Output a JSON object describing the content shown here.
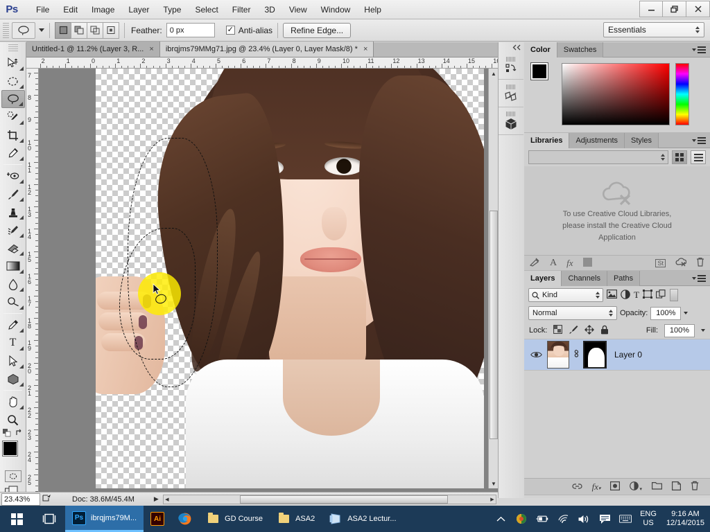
{
  "app": {
    "name": "Ps",
    "workspace": "Essentials"
  },
  "menubar": {
    "items": [
      {
        "label": "File"
      },
      {
        "label": "Edit"
      },
      {
        "label": "Image"
      },
      {
        "label": "Layer"
      },
      {
        "label": "Type"
      },
      {
        "label": "Select"
      },
      {
        "label": "Filter"
      },
      {
        "label": "3D"
      },
      {
        "label": "View"
      },
      {
        "label": "Window"
      },
      {
        "label": "Help"
      }
    ]
  },
  "window_controls": {
    "minimize": "—",
    "restore": "❐",
    "close": "✕"
  },
  "options_bar": {
    "tool": "lasso-tool",
    "modes": [
      {
        "name": "new-selection",
        "active": true
      },
      {
        "name": "add-to-selection",
        "active": false
      },
      {
        "name": "subtract-from-selection",
        "active": false
      },
      {
        "name": "intersect-with-selection",
        "active": false
      }
    ],
    "feather_label": "Feather:",
    "feather_value": "0 px",
    "antialias_label": "Anti-alias",
    "antialias_checked": true,
    "refine_edge_label": "Refine Edge..."
  },
  "document_tabs": [
    {
      "title": "Untitled-1 @ 11.2% (Layer 3, R...",
      "active": false,
      "close": "×"
    },
    {
      "title": "ibrqjms79MMg71.jpg @ 23.4% (Layer 0, Layer Mask/8) *",
      "active": true,
      "close": "×"
    }
  ],
  "toolbox": {
    "tools": [
      {
        "name": "move-tool",
        "glyph": "✥",
        "selected": false
      },
      {
        "name": "elliptical-marquee-tool",
        "glyph": "○",
        "selected": false
      },
      {
        "name": "lasso-tool",
        "glyph": "℘",
        "selected": true
      },
      {
        "name": "quick-selection-tool",
        "glyph": "✒",
        "selected": false
      },
      {
        "name": "crop-tool",
        "glyph": "⌗",
        "selected": false
      },
      {
        "name": "eyedropper-tool",
        "glyph": "✎",
        "selected": false
      },
      {
        "name": "spot-healing-brush-tool",
        "glyph": "◎",
        "selected": false
      },
      {
        "name": "brush-tool",
        "glyph": "✐",
        "selected": false
      },
      {
        "name": "clone-stamp-tool",
        "glyph": "⚑",
        "selected": false
      },
      {
        "name": "history-brush-tool",
        "glyph": "✒",
        "selected": false
      },
      {
        "name": "eraser-tool",
        "glyph": "◢",
        "selected": false
      },
      {
        "name": "gradient-tool",
        "glyph": "■",
        "selected": false
      },
      {
        "name": "blur-tool",
        "glyph": "○",
        "selected": false
      },
      {
        "name": "dodge-tool",
        "glyph": "◔",
        "selected": false
      },
      {
        "name": "pen-tool",
        "glyph": "✒",
        "selected": false
      },
      {
        "name": "horizontal-type-tool",
        "glyph": "T",
        "selected": false
      },
      {
        "name": "path-selection-tool",
        "glyph": "➤",
        "selected": false
      },
      {
        "name": "polygon-tool",
        "glyph": "⬡",
        "selected": false
      },
      {
        "name": "hand-tool",
        "glyph": "✋",
        "selected": false
      },
      {
        "name": "zoom-tool",
        "glyph": "⚲",
        "selected": false
      }
    ],
    "foreground_color": "#000000",
    "background_color": "#ffffff"
  },
  "rulers": {
    "horizontal_ticks": [
      "2",
      "1",
      "0",
      "1",
      "2",
      "3",
      "4",
      "5",
      "6",
      "7",
      "8",
      "9",
      "10",
      "11",
      "12",
      "13",
      "14",
      "15",
      "16"
    ],
    "vertical_ticks": [
      "7",
      "8",
      "9",
      "10",
      "11",
      "12",
      "13",
      "14",
      "15",
      "16",
      "17",
      "18",
      "19",
      "20",
      "21",
      "22",
      "23",
      "24",
      "25"
    ]
  },
  "canvas": {
    "brush_overlay_color": "#ffed00",
    "cursor": "lasso-cursor"
  },
  "status_bar": {
    "zoom": "23.43%",
    "doc_info": "Doc: 38.6M/45.4M"
  },
  "dock_rail": {
    "buttons": [
      {
        "name": "history-panel-icon"
      },
      {
        "name": "properties-panel-icon"
      },
      {
        "name": "3d-panel-icon"
      }
    ],
    "collapse": "«"
  },
  "color_panel": {
    "tabs": [
      {
        "label": "Color",
        "active": true
      },
      {
        "label": "Swatches",
        "active": false
      }
    ],
    "foreground": "#000000",
    "background": "#ffffff"
  },
  "libraries_panel": {
    "tabs": [
      {
        "label": "Libraries",
        "active": true
      },
      {
        "label": "Adjustments",
        "active": false
      },
      {
        "label": "Styles",
        "active": false
      }
    ],
    "select_value": "",
    "message_line1": "To use Creative Cloud Libraries,",
    "message_line2": "please install the Creative Cloud",
    "message_line3": "Application",
    "footer_icons": [
      {
        "name": "fill-icon",
        "glyph": "◢"
      },
      {
        "name": "text-style-icon",
        "glyph": "A"
      },
      {
        "name": "layer-style-icon",
        "glyph": "fx"
      },
      {
        "name": "graphic-icon",
        "glyph": "■"
      },
      {
        "name": "library-sync-icon",
        "glyph": "St"
      },
      {
        "name": "cloud-off-icon",
        "glyph": "☁"
      },
      {
        "name": "delete-icon",
        "glyph": "Ὕ1"
      }
    ]
  },
  "layers_panel": {
    "tabs": [
      {
        "label": "Layers",
        "active": true
      },
      {
        "label": "Channels",
        "active": false
      },
      {
        "label": "Paths",
        "active": false
      }
    ],
    "filter_kind": "Kind",
    "filter_icons": [
      {
        "name": "filter-pixel-layers-icon",
        "glyph": "⛰"
      },
      {
        "name": "filter-adjustment-layers-icon",
        "glyph": "◑"
      },
      {
        "name": "filter-type-layers-icon",
        "glyph": "T"
      },
      {
        "name": "filter-shape-layers-icon",
        "glyph": "⬚"
      },
      {
        "name": "filter-smart-objects-icon",
        "glyph": "❐"
      }
    ],
    "blend_mode": "Normal",
    "opacity_label": "Opacity:",
    "opacity_value": "100%",
    "lock_label": "Lock:",
    "lock_icons": [
      {
        "name": "lock-transparent-pixels-icon",
        "glyph": "▨"
      },
      {
        "name": "lock-image-pixels-icon",
        "glyph": "✐"
      },
      {
        "name": "lock-position-icon",
        "glyph": "✥"
      },
      {
        "name": "lock-all-icon",
        "glyph": "ὑ2"
      }
    ],
    "fill_label": "Fill:",
    "fill_value": "100%",
    "layers": [
      {
        "name": "Layer 0",
        "visible": true,
        "has_mask": true,
        "linked": true,
        "selected": true
      }
    ],
    "footer_icons": [
      {
        "name": "link-layers-icon",
        "glyph": "⚭"
      },
      {
        "name": "layer-style-fx-icon",
        "glyph": "fx"
      },
      {
        "name": "add-layer-mask-icon",
        "glyph": "▣"
      },
      {
        "name": "new-adjustment-layer-icon",
        "glyph": "◑"
      },
      {
        "name": "new-group-icon",
        "glyph": "▱"
      },
      {
        "name": "new-layer-icon",
        "glyph": "❐"
      },
      {
        "name": "delete-layer-icon",
        "glyph": "Ὕ1"
      }
    ]
  },
  "taskbar": {
    "start": "start-button",
    "task_view": "task-view-button",
    "items": [
      {
        "label": "ibrqjms79M...",
        "icon": "Ps",
        "active": true
      },
      {
        "label": "",
        "icon": "Ai",
        "active": false
      },
      {
        "label": "",
        "icon": "firefox",
        "active": false
      },
      {
        "label": "GD Course",
        "icon": "folder",
        "active": false
      },
      {
        "label": "ASA2",
        "icon": "folder",
        "active": false
      },
      {
        "label": "ASA2 Lectur...",
        "icon": "powerpoint",
        "active": false
      }
    ],
    "tray": [
      {
        "name": "show-hidden-icons-chevron",
        "glyph": "⌃"
      },
      {
        "name": "security-shield-icon",
        "glyph": "●"
      },
      {
        "name": "battery-icon",
        "glyph": "▭"
      },
      {
        "name": "wifi-icon",
        "glyph": "◠"
      },
      {
        "name": "volume-icon",
        "glyph": "◁"
      },
      {
        "name": "action-center-icon",
        "glyph": "▤"
      },
      {
        "name": "keyboard-icon",
        "glyph": "⌨"
      }
    ],
    "language_line1": "ENG",
    "language_line2": "US",
    "time": "9:16 AM",
    "date": "12/14/2015"
  }
}
